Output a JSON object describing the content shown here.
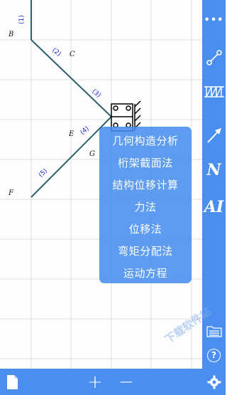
{
  "colors": {
    "accent": "#4a8ff0",
    "member_line": "#2d5e6e",
    "member_label": "#1a2ad8",
    "grid": "#dddddd"
  },
  "canvas": {
    "nodes": [
      {
        "label": "B"
      },
      {
        "label": "C"
      },
      {
        "label": "E"
      },
      {
        "label": "G"
      },
      {
        "label": "F"
      }
    ],
    "members": [
      {
        "label": "(1)"
      },
      {
        "label": "(2)"
      },
      {
        "label": "(3)"
      },
      {
        "label": "(4)"
      },
      {
        "label": "(5)"
      }
    ]
  },
  "context_menu": {
    "items": [
      "几何构造分析",
      "桁架截面法",
      "结构位移计算",
      "力法",
      "位移法",
      "弯矩分配法",
      "运动方程"
    ]
  },
  "sidebar": {
    "items": [
      {
        "icon": "more-icon",
        "label": "•••"
      },
      {
        "icon": "bar-element-icon",
        "label": ""
      },
      {
        "icon": "truss-icon",
        "label": ""
      },
      {
        "icon": "arrow-load-icon",
        "label": ""
      },
      {
        "icon": "normal-force-icon",
        "label": "N"
      },
      {
        "icon": "ai-icon",
        "label": "AI"
      },
      {
        "icon": "file-list-icon",
        "label": ""
      },
      {
        "icon": "help-icon",
        "label": "?"
      }
    ]
  },
  "bottom_bar": {
    "plus_label": "+",
    "minus_label": "−"
  },
  "watermark": {
    "text": "下载软件站"
  }
}
